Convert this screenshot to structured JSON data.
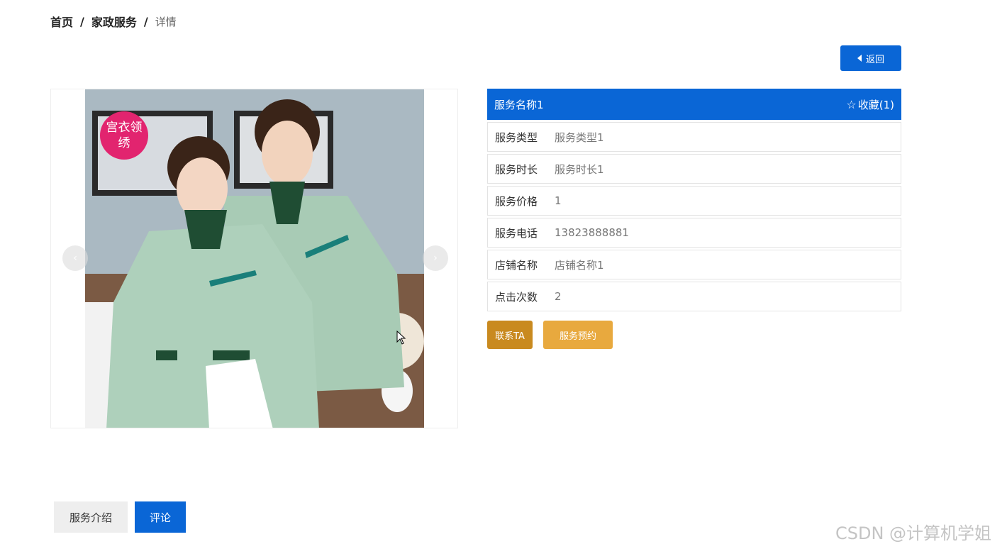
{
  "breadcrumb": {
    "home": "首页",
    "section": "家政服务",
    "current": "详情",
    "separator": "/"
  },
  "back_button": {
    "label": "返回"
  },
  "carousel": {
    "image_badge": "宫衣领绣",
    "prev_icon": "chevron-left-icon",
    "next_icon": "chevron-right-icon"
  },
  "detail": {
    "title": "服务名称1",
    "favorite_label": "收藏(1)",
    "rows": [
      {
        "label": "服务类型",
        "value": "服务类型1"
      },
      {
        "label": "服务时长",
        "value": "服务时长1"
      },
      {
        "label": "服务价格",
        "value": "1"
      },
      {
        "label": "服务电话",
        "value": "13823888881"
      },
      {
        "label": "店铺名称",
        "value": "店铺名称1"
      },
      {
        "label": "点击次数",
        "value": "2"
      }
    ]
  },
  "actions": {
    "contact_label": "联系TA",
    "book_label": "服务预约"
  },
  "tabs": [
    {
      "label": "服务介绍",
      "active": false
    },
    {
      "label": "评论",
      "active": true
    }
  ],
  "watermark": "CSDN @计算机学姐",
  "colors": {
    "primary": "#0a66d6",
    "contact": "#c98a1f",
    "book": "#e8a93e"
  }
}
